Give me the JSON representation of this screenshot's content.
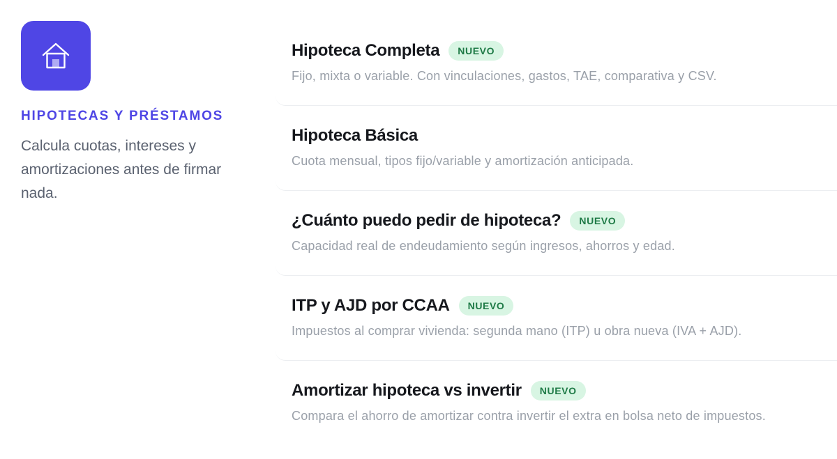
{
  "category": {
    "icon": "house-icon",
    "accent_color": "#4f46e5",
    "title": "HIPOTECAS Y PRÉSTAMOS",
    "description": "Calcula cuotas, intereses y amortizaciones antes de firmar nada."
  },
  "badge_color": "#d8f5e3",
  "tools": [
    {
      "title": "Hipoteca Completa",
      "badge": "NUEVO",
      "description": "Fijo, mixta o variable. Con vinculaciones, gastos, TAE, comparativa y CSV."
    },
    {
      "title": "Hipoteca Básica",
      "badge": "",
      "description": "Cuota mensual, tipos fijo/variable y amortización anticipada."
    },
    {
      "title": "¿Cuánto puedo pedir de hipoteca?",
      "badge": "NUEVO",
      "description": "Capacidad real de endeudamiento según ingresos, ahorros y edad."
    },
    {
      "title": "ITP y AJD por CCAA",
      "badge": "NUEVO",
      "description": "Impuestos al comprar vivienda: segunda mano (ITP) u obra nueva (IVA + AJD)."
    },
    {
      "title": "Amortizar hipoteca vs invertir",
      "badge": "NUEVO",
      "description": "Compara el ahorro de amortizar contra invertir el extra en bolsa neto de impuestos."
    }
  ]
}
